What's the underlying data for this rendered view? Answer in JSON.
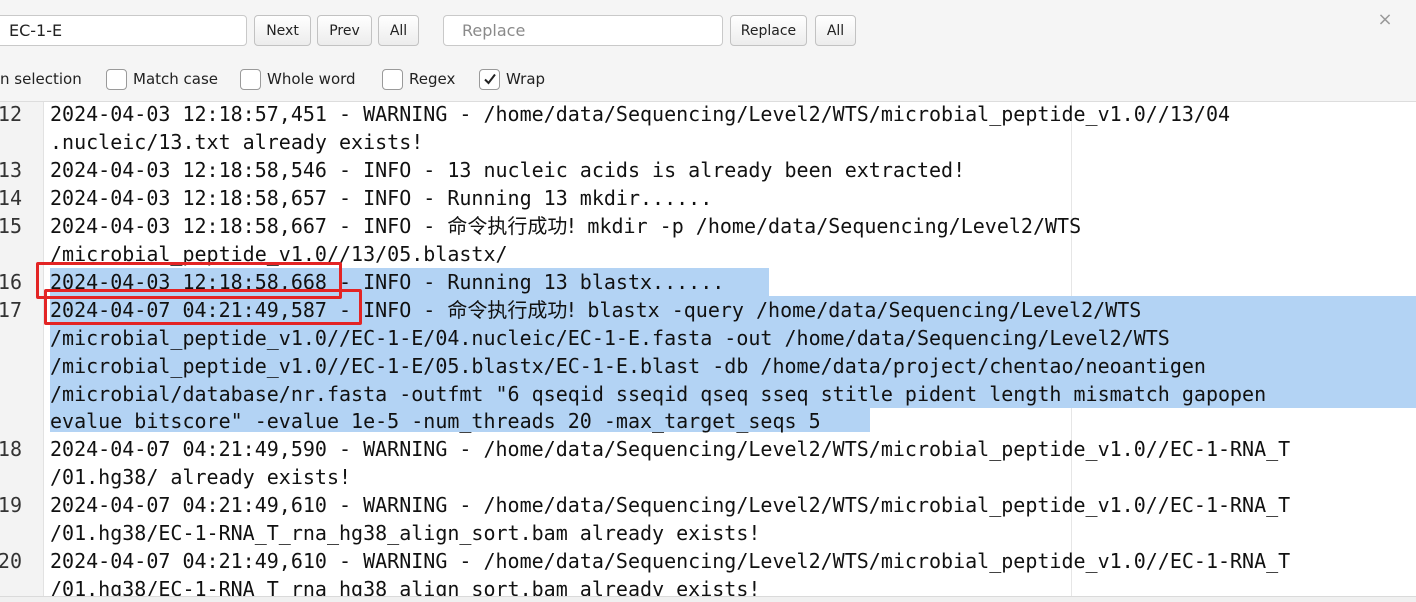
{
  "search": {
    "find_value": "EC-1-E",
    "next_label": "Next",
    "prev_label": "Prev",
    "all_label": "All",
    "replace_placeholder": "Replace",
    "replace_label": "Replace",
    "replace_all_label": "All",
    "close_glyph": "×",
    "options": {
      "in_selection": "n selection",
      "match_case": "Match case",
      "whole_word": "Whole word",
      "regex": "Regex",
      "wrap": "Wrap",
      "wrap_checked": true
    }
  },
  "editor": {
    "line_numbers": [
      "12",
      "13",
      "14",
      "15",
      "16",
      "17",
      "18",
      "19",
      "20"
    ],
    "lines": {
      "l12a": "2024-04-03 12:18:57,451 - WARNING - /home/data/Sequencing/Level2/WTS/microbial_peptide_v1.0//13/04",
      "l12b": ".nucleic/13.txt already exists!",
      "l13": "2024-04-03 12:18:58,546 - INFO - 13 nucleic acids is already been extracted!",
      "l14": "2024-04-03 12:18:58,657 - INFO - Running 13 mkdir......",
      "l15a_pre": "2024-04-03 12:18:58,667 - INFO - ",
      "l15a_cjk": "命令执行成功!",
      "l15a_post": " mkdir -p /home/data/Sequencing/Level2/WTS",
      "l15b": "/microbial_peptide_v1.0//13/05.blastx/",
      "l16": "2024-04-03 12:18:58,668 - INFO - Running 13 blastx......",
      "l17a_pre": "2024-04-07 04:21:49,587 - INFO - ",
      "l17a_cjk": "命令执行成功!",
      "l17a_post": " blastx -query /home/data/Sequencing/Level2/WTS",
      "l17b": "/microbial_peptide_v1.0//EC-1-E/04.nucleic/EC-1-E.fasta -out /home/data/Sequencing/Level2/WTS",
      "l17c": "/microbial_peptide_v1.0//EC-1-E/05.blastx/EC-1-E.blast -db /home/data/project/chentao/neoantigen",
      "l17d": "/microbial/database/nr.fasta -outfmt \"6 qseqid sseqid qseq sseq stitle pident length mismatch gapopen",
      "l17e": "evalue bitscore\" -evalue 1e-5 -num_threads 20 -max_target_seqs 5",
      "l18a": "2024-04-07 04:21:49,590 - WARNING - /home/data/Sequencing/Level2/WTS/microbial_peptide_v1.0//EC-1-RNA_T",
      "l18b": "/01.hg38/ already exists!",
      "l19a": "2024-04-07 04:21:49,610 - WARNING - /home/data/Sequencing/Level2/WTS/microbial_peptide_v1.0//EC-1-RNA_T",
      "l19b": "/01.hg38/EC-1-RNA_T_rna_hg38_align_sort.bam already exists!",
      "l20a": "2024-04-07 04:21:49,610 - WARNING - /home/data/Sequencing/Level2/WTS/microbial_peptide_v1.0//EC-1-RNA_T",
      "l20b": "/01.hg38/EC-1-RNA_T_rna_hg38_align_sort.bam already exists!"
    }
  },
  "colors": {
    "selection": "#b3d3f4",
    "annotation_box": "#e32424"
  }
}
